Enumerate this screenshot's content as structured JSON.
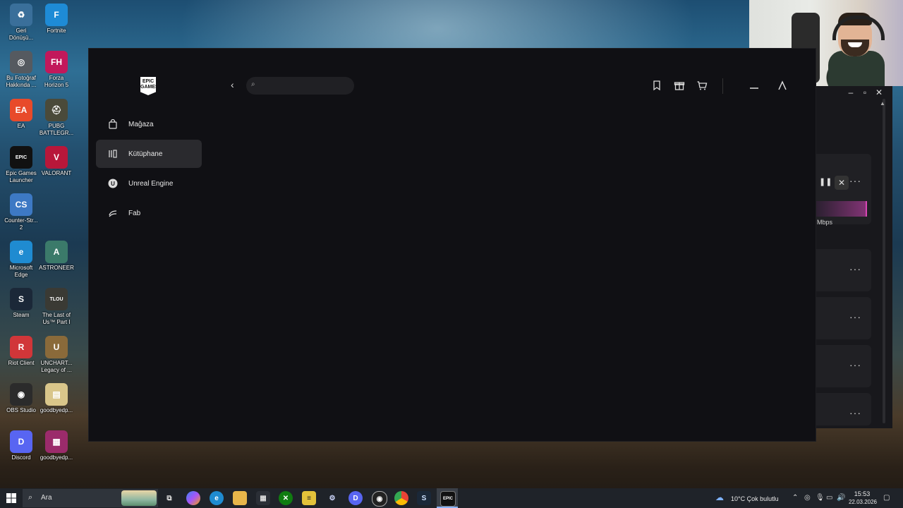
{
  "desktop": {
    "icons": [
      {
        "label": "Geri\nDönüşü...",
        "color": "#3a6f9a",
        "glyph": "♻"
      },
      {
        "label": "Fortnite",
        "color": "#1e8bd6",
        "glyph": "F"
      },
      {
        "label": "Bu Fotoğraf\nHakkında ...",
        "color": "#555a60",
        "glyph": "◎"
      },
      {
        "label": "Forza\nHorizon 5",
        "color": "#c2185b",
        "glyph": "FH"
      },
      {
        "label": "EA",
        "color": "#e84a2a",
        "glyph": "EA"
      },
      {
        "label": "PUBG\nBATTLEGR...",
        "color": "#4a4a3a",
        "glyph": "⛑"
      },
      {
        "label": "Epic Games\nLauncher",
        "color": "#111111",
        "glyph": "EPIC"
      },
      {
        "label": "VALORANT",
        "color": "#b8173a",
        "glyph": "V"
      },
      {
        "label": "Counter-Str...\n2",
        "color": "#3d79c4",
        "glyph": "CS"
      },
      {
        "label": "Microsoft\nEdge",
        "color": "#1f8bd1",
        "glyph": "e"
      },
      {
        "label": "ASTRONEER",
        "color": "#3b7a6a",
        "glyph": "A"
      },
      {
        "label": "Steam",
        "color": "#1b2838",
        "glyph": "S"
      },
      {
        "label": "The Last of\nUs™ Part I",
        "color": "#3a3a34",
        "glyph": "TLOU"
      },
      {
        "label": "Riot Client",
        "color": "#d13639",
        "glyph": "R"
      },
      {
        "label": "UNCHART...\nLegacy of ...",
        "color": "#8a6a3a",
        "glyph": "U"
      },
      {
        "label": "OBS Studio",
        "color": "#2b2b2b",
        "glyph": "◉"
      },
      {
        "label": "goodbyedp...",
        "color": "#d9c68a",
        "glyph": "▤"
      },
      {
        "label": "Discord",
        "color": "#5865f2",
        "glyph": "D"
      },
      {
        "label": "goodbyedp...",
        "color": "#9b2b6b",
        "glyph": "▦"
      }
    ]
  },
  "epic": {
    "logo_text": "EPIC\nGAMES",
    "search": {
      "placeholder": "",
      "value": ""
    },
    "nav": [
      {
        "label": "Mağaza",
        "icon": "bag-icon",
        "active": false
      },
      {
        "label": "Kütüphane",
        "icon": "library-icon",
        "active": true
      },
      {
        "label": "Unreal Engine",
        "icon": "unreal-icon",
        "active": false
      },
      {
        "label": "Fab",
        "icon": "fab-icon",
        "active": false
      }
    ],
    "top_icons": [
      "bookmark-icon",
      "gift-icon",
      "cart-icon",
      "friends-icon",
      "account-icon"
    ]
  },
  "downloads": {
    "rate_unit": "Mbps",
    "menu_label": "···"
  },
  "taskbar": {
    "search_label": "Ara",
    "weather": "10°C  Çok bulutlu",
    "time": "15:53",
    "date": "22.03.2026"
  }
}
